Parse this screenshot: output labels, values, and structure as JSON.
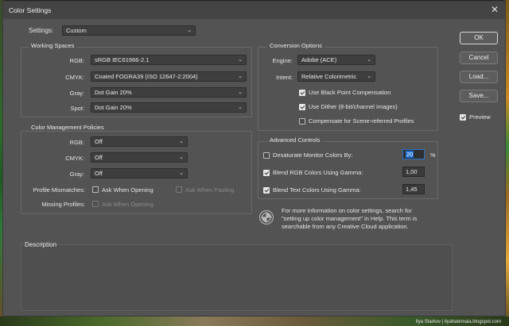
{
  "window": {
    "title": "Color Settings",
    "close_glyph": "✕"
  },
  "settings": {
    "label": "Settings:",
    "value": "Custom"
  },
  "working_spaces": {
    "title": "Working Spaces",
    "rgb": {
      "label": "RGB:",
      "value": "sRGB IEC61966-2.1"
    },
    "cmyk": {
      "label": "CMYK:",
      "value": "Coated FOGRA39 (ISO 12647-2:2004)"
    },
    "gray": {
      "label": "Gray:",
      "value": "Dot Gain 20%"
    },
    "spot": {
      "label": "Spot:",
      "value": "Dot Gain 20%"
    }
  },
  "policies": {
    "title": "Color Management Policies",
    "rgb": {
      "label": "RGB:",
      "value": "Off"
    },
    "cmyk": {
      "label": "CMYK:",
      "value": "Off"
    },
    "gray": {
      "label": "Gray:",
      "value": "Off"
    },
    "mismatch_label": "Profile Mismatches:",
    "ask_opening": "Ask When Opening",
    "ask_pasting": "Ask When Pasting",
    "missing_label": "Missing Profiles:",
    "missing_ask_opening": "Ask When Opening"
  },
  "conversion": {
    "title": "Conversion Options",
    "engine": {
      "label": "Engine:",
      "value": "Adobe (ACE)"
    },
    "intent": {
      "label": "Intent:",
      "value": "Relative Colorimetric"
    },
    "black_point": "Use Black Point Compensation",
    "dither": "Use Dither (8-bit/channel images)",
    "scene_referred": "Compensate for Scene-referred Profiles"
  },
  "advanced": {
    "title": "Advanced Controls",
    "desaturate": "Desaturate Monitor Colors By:",
    "desaturate_value": "20",
    "desaturate_unit": "%",
    "blend_rgb": "Blend RGB Colors Using Gamma:",
    "blend_rgb_value": "1,00",
    "blend_text": "Blend Text Colors Using Gamma:",
    "blend_text_value": "1,45"
  },
  "info_text": {
    "line1": "For more information on color settings, search for",
    "line2": "\"setting up color management\" in Help. This term is",
    "line3": "searchable from any Creative Cloud application."
  },
  "description": {
    "title": "Description"
  },
  "buttons": {
    "ok": "OK",
    "cancel": "Cancel",
    "load": "Load...",
    "save": "Save...",
    "preview": "Preview"
  },
  "dropdown_chevron": "⌄",
  "watermark": "Ilya Starkov | ilyahatemaia.blogspot.com"
}
